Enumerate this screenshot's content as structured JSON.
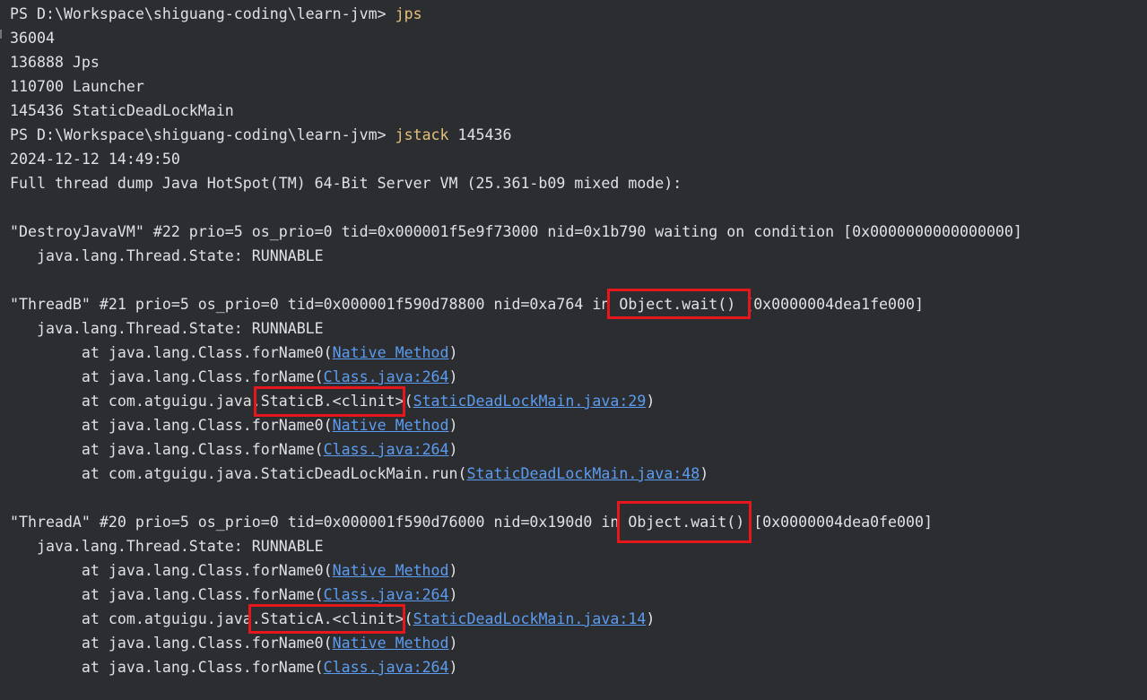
{
  "colors": {
    "background": "#2b2d30",
    "text": "#dfe1e5",
    "command": "#e5c07b",
    "link": "#5c9cf0",
    "highlight_box": "#e5161c"
  },
  "lines": {
    "l1": {
      "prompt": "PS D:\\Workspace\\shiguang-coding\\learn-jvm> ",
      "cmd": "jps"
    },
    "l2": {
      "text": "36004"
    },
    "l3": {
      "text": "136888 Jps"
    },
    "l4": {
      "text": "110700 Launcher"
    },
    "l5": {
      "text": "145436 StaticDeadLockMain"
    },
    "l6": {
      "prompt": "PS D:\\Workspace\\shiguang-coding\\learn-jvm> ",
      "cmd": "jstack",
      "arg": " 145436"
    },
    "l7": {
      "text": "2024-12-12 14:49:50"
    },
    "l8": {
      "text": "Full thread dump Java HotSpot(TM) 64-Bit Server VM (25.361-b09 mixed mode):"
    },
    "l10": {
      "text": "\"DestroyJavaVM\" #22 prio=5 os_prio=0 tid=0x000001f5e9f73000 nid=0x1b790 waiting on condition [0x0000000000000000]"
    },
    "l11": {
      "text": "   java.lang.Thread.State: RUNNABLE"
    },
    "l13": {
      "text": "\"ThreadB\" #21 prio=5 os_prio=0 tid=0x000001f590d78800 nid=0xa764 in Object.wait() [0x0000004dea1fe000]"
    },
    "l14": {
      "text": "   java.lang.Thread.State: RUNNABLE"
    },
    "l15": {
      "pre": "        at java.lang.Class.forName0(",
      "link": "Native Method",
      "post": ")"
    },
    "l16": {
      "pre": "        at java.lang.Class.forName(",
      "link": "Class.java:264",
      "post": ")"
    },
    "l17": {
      "pre": "        at com.atguigu.java.StaticB.<clinit>(",
      "link": "StaticDeadLockMain.java:29",
      "post": ")"
    },
    "l18": {
      "pre": "        at java.lang.Class.forName0(",
      "link": "Native Method",
      "post": ")"
    },
    "l19": {
      "pre": "        at java.lang.Class.forName(",
      "link": "Class.java:264",
      "post": ")"
    },
    "l20": {
      "pre": "        at com.atguigu.java.StaticDeadLockMain.run(",
      "link": "StaticDeadLockMain.java:48",
      "post": ")"
    },
    "l22": {
      "text": "\"ThreadA\" #20 prio=5 os_prio=0 tid=0x000001f590d76000 nid=0x190d0 in Object.wait() [0x0000004dea0fe000]"
    },
    "l23": {
      "text": "   java.lang.Thread.State: RUNNABLE"
    },
    "l24": {
      "pre": "        at java.lang.Class.forName0(",
      "link": "Native Method",
      "post": ")"
    },
    "l25": {
      "pre": "        at java.lang.Class.forName(",
      "link": "Class.java:264",
      "post": ")"
    },
    "l26": {
      "pre": "        at com.atguigu.java.StaticA.<clinit>(",
      "link": "StaticDeadLockMain.java:14",
      "post": ")"
    },
    "l27": {
      "pre": "        at java.lang.Class.forName0(",
      "link": "Native Method",
      "post": ")"
    },
    "l28": {
      "pre": "        at java.lang.Class.forName(",
      "link": "Class.java:264",
      "post": ")"
    }
  }
}
